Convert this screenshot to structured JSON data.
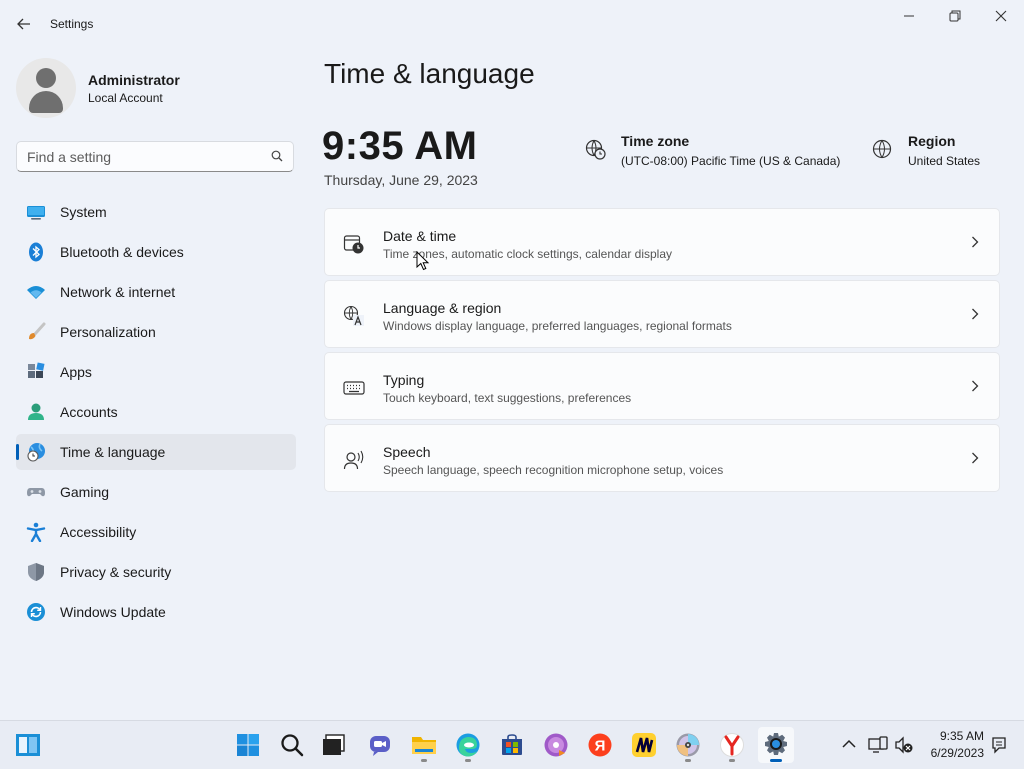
{
  "window": {
    "title": "Settings"
  },
  "profile": {
    "name": "Administrator",
    "account_type": "Local Account"
  },
  "search": {
    "placeholder": "Find a setting"
  },
  "sidebar": {
    "items": [
      {
        "label": "System",
        "icon": "monitor-icon"
      },
      {
        "label": "Bluetooth & devices",
        "icon": "bluetooth-icon"
      },
      {
        "label": "Network & internet",
        "icon": "wifi-icon"
      },
      {
        "label": "Personalization",
        "icon": "paintbrush-icon"
      },
      {
        "label": "Apps",
        "icon": "apps-icon"
      },
      {
        "label": "Accounts",
        "icon": "person-icon"
      },
      {
        "label": "Time & language",
        "icon": "globe-clock-icon",
        "active": true
      },
      {
        "label": "Gaming",
        "icon": "gamepad-icon"
      },
      {
        "label": "Accessibility",
        "icon": "accessibility-icon"
      },
      {
        "label": "Privacy & security",
        "icon": "shield-icon"
      },
      {
        "label": "Windows Update",
        "icon": "update-icon"
      }
    ]
  },
  "main": {
    "title": "Time & language",
    "time": "9:35 AM",
    "date": "Thursday, June 29, 2023",
    "time_zone": {
      "label": "Time zone",
      "value": "(UTC-08:00) Pacific Time (US & Canada)"
    },
    "region": {
      "label": "Region",
      "value": "United States"
    },
    "cards": [
      {
        "title": "Date & time",
        "description": "Time zones, automatic clock settings, calendar display",
        "icon": "calendar-clock-icon"
      },
      {
        "title": "Language & region",
        "description": "Windows display language, preferred languages, regional formats",
        "icon": "language-icon"
      },
      {
        "title": "Typing",
        "description": "Touch keyboard, text suggestions, preferences",
        "icon": "keyboard-icon"
      },
      {
        "title": "Speech",
        "description": "Speech language, speech recognition microphone setup, voices",
        "icon": "speech-icon"
      }
    ]
  },
  "taskbar": {
    "apps": [
      "widgets-icon",
      "start-icon",
      "search-icon",
      "task-view-icon",
      "chat-icon",
      "file-explorer-icon",
      "edge-icon",
      "store-icon",
      "media-app-icon",
      "yandex-icon",
      "miro-icon",
      "disc-icon",
      "yandex-browser-icon",
      "settings-icon"
    ],
    "clock_time": "9:35 AM",
    "clock_date": "6/29/2023"
  },
  "colors": {
    "accent": "#005fb8",
    "window_bg": "#eef2f9"
  }
}
